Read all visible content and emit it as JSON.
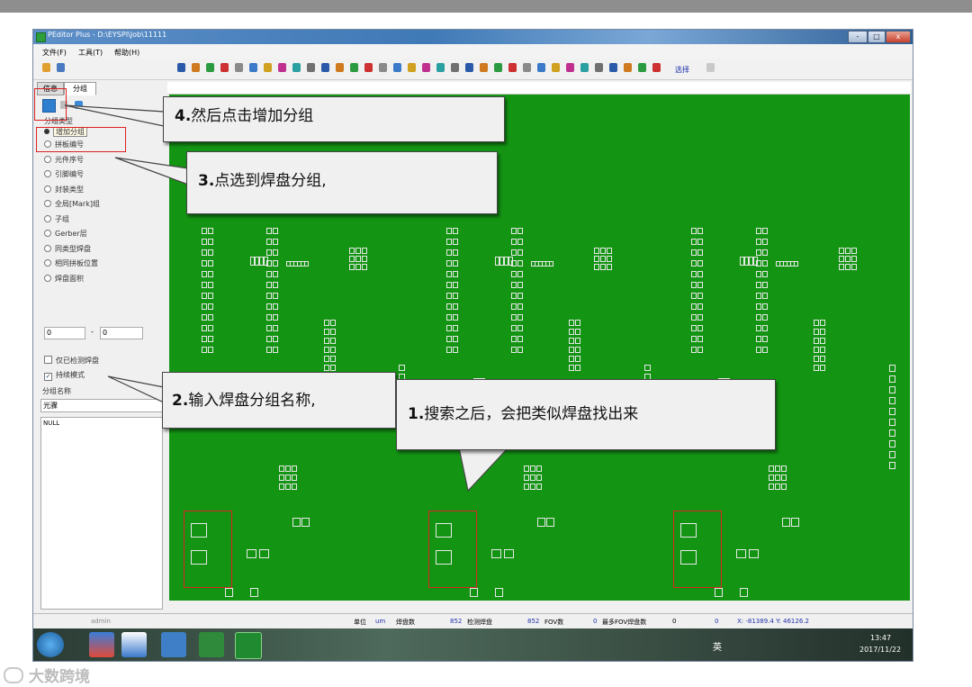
{
  "window": {
    "title": "PEditor Plus - D:\\EYSPI\\Job\\11111",
    "controls": [
      "-",
      "□",
      "x"
    ]
  },
  "menu": [
    "文件(F)",
    "工具(T)",
    "帮助(H)"
  ],
  "toolbar": {
    "select_label": "选择"
  },
  "left_panel": {
    "tabs": [
      "信息",
      "分组"
    ],
    "group_type_label": "分组类型",
    "add_group_tooltip": "增加分组",
    "group_options": [
      {
        "label": "拼板编号",
        "selected": false
      },
      {
        "label": "元件序号",
        "selected": false
      },
      {
        "label": "引脚编号",
        "selected": false
      },
      {
        "label": "封装类型",
        "selected": false
      },
      {
        "label": "全局[Mark]组",
        "selected": false
      },
      {
        "label": "子组",
        "selected": false
      },
      {
        "label": "Gerber层",
        "selected": false
      },
      {
        "label": "同类型焊盘",
        "selected": false
      },
      {
        "label": "相同拼板位置",
        "selected": false
      },
      {
        "label": "焊盘面积",
        "selected": false
      }
    ],
    "area_from": "0",
    "area_separator": "-",
    "area_to": "0",
    "only_checked_label": "仅已检测焊盘",
    "continuous_mode_label": "持续模式",
    "continuous_checked": true,
    "group_name_label": "分组名称",
    "group_name_value": "光骤",
    "list_items": [
      "NULL"
    ]
  },
  "callouts": {
    "step4": {
      "num": "4.",
      "text": "然后点击增加分组"
    },
    "step3": {
      "num": "3.",
      "text": "点选到焊盘分组,"
    },
    "step2": {
      "num": "2.",
      "text": "输入焊盘分组名称,"
    },
    "step1": {
      "num": "1.",
      "text": "搜索之后，会把类似焊盘找出来"
    }
  },
  "status_bar": {
    "user": "admin",
    "unit_label": "单位",
    "unit_value": "um",
    "pad_count_label": "焊盘数",
    "pad_count": "852",
    "checked_label": "检测焊盘",
    "checked_count": "852",
    "fov_label": "FOV数",
    "fov_count": "0",
    "max_fov_label": "最多FOV焊盘数",
    "max_fov_count": "0",
    "extra_value": "0",
    "coords": "X: -81389.4  Y: 46126.2"
  },
  "taskbar": {
    "time": "13:47",
    "date": "2017/11/22",
    "lang": "英"
  },
  "watermark": "大数跨境",
  "colors": {
    "pcb": "#139413",
    "pad": "#e8e8e8",
    "highlight": "#d22222",
    "window_frame": "#3f79b6"
  }
}
